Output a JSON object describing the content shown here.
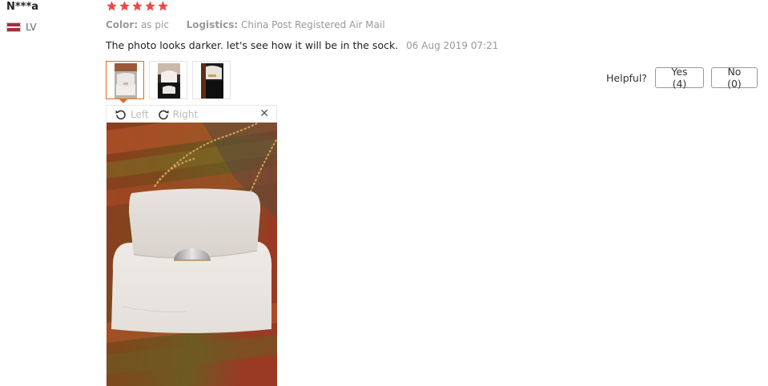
{
  "reviewer": {
    "name": "N***a",
    "country": "LV"
  },
  "rating": {
    "stars": 5,
    "color": "#f04848"
  },
  "meta": {
    "color_key": "Color:",
    "color_value": "as pic",
    "logistics_key": "Logistics:",
    "logistics_value": "China Post Registered Air Mail"
  },
  "review": {
    "text": "The photo looks darker. let's see how it will be in the sock.",
    "date": "06 Aug 2019 07:21"
  },
  "thumbnails": {
    "count": 3,
    "active_index": 0
  },
  "helpful": {
    "label": "Helpful?",
    "yes_label": "Yes (4)",
    "no_label": "No (0)"
  },
  "viewer": {
    "left_label": "Left",
    "right_label": "Right",
    "close_icon": "close-icon",
    "accent": "#e36b1c"
  }
}
